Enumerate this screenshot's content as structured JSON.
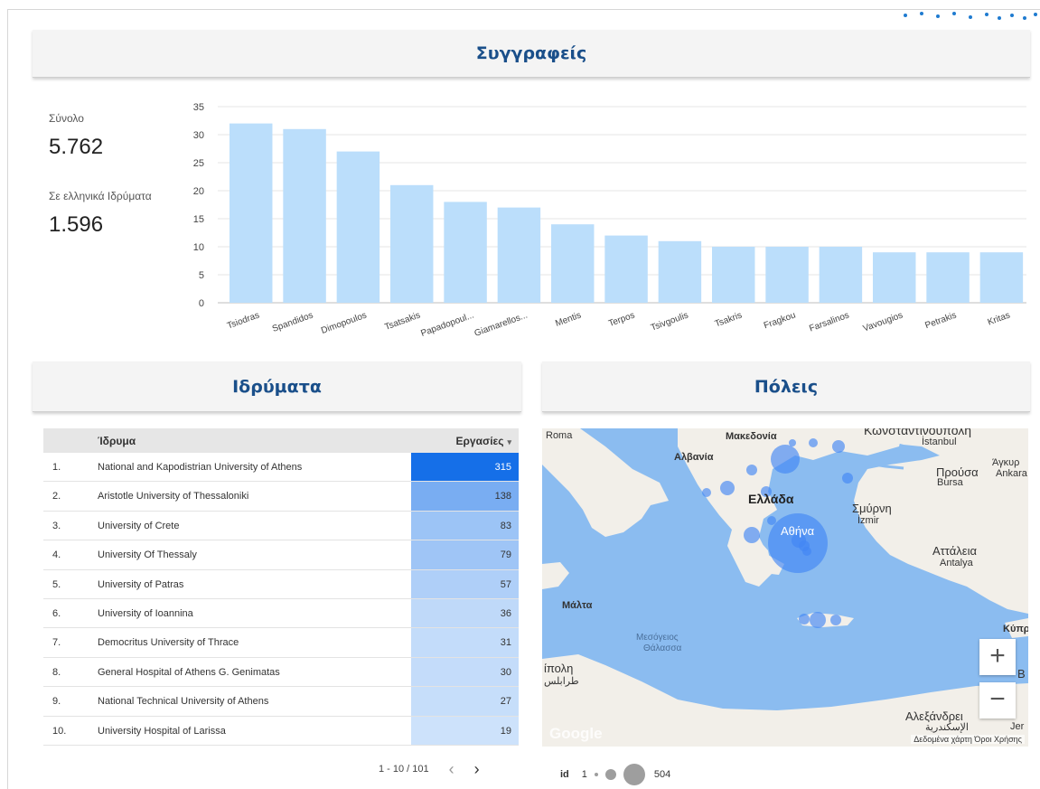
{
  "header_authors": "Συγγραφείς",
  "header_institutions": "Ιδρύματα",
  "header_cities": "Πόλεις",
  "kpis": {
    "total_label": "Σύνολο",
    "total_value": "5.762",
    "greek_label": "Σε ελληνικά Ιδρύματα",
    "greek_value": "1.596"
  },
  "chart_data": {
    "type": "bar",
    "categories": [
      "Tsiodras",
      "Spandidos",
      "Dimopoulos",
      "Tsatsakis",
      "Papadopoul...",
      "Giamarellos...",
      "Mentis",
      "Terpos",
      "Tsivgoulis",
      "Tsakris",
      "Fragkou",
      "Farsalinos",
      "Vavougios",
      "Petrakis",
      "Kritas"
    ],
    "values": [
      32,
      31,
      27,
      21,
      18,
      17,
      14,
      12,
      11,
      10,
      10,
      10,
      9,
      9,
      9
    ],
    "ylim": [
      0,
      35
    ],
    "yticks": [
      0,
      5,
      10,
      15,
      20,
      25,
      30,
      35
    ],
    "grid": true,
    "bar_color": "#bbdefb"
  },
  "table": {
    "col_institution": "Ίδρυμα",
    "col_works": "Εργασίες",
    "rows": [
      {
        "rank": "1.",
        "name": "National and Kapodistrian University of Athens",
        "count": "315",
        "value": 315
      },
      {
        "rank": "2.",
        "name": "Aristotle University of Thessaloniki",
        "count": "138",
        "value": 138
      },
      {
        "rank": "3.",
        "name": "University of Crete",
        "count": "83",
        "value": 83
      },
      {
        "rank": "4.",
        "name": "University Of Thessaly",
        "count": "79",
        "value": 79
      },
      {
        "rank": "5.",
        "name": "University of Patras",
        "count": "57",
        "value": 57
      },
      {
        "rank": "6.",
        "name": "University of Ioannina",
        "count": "36",
        "value": 36
      },
      {
        "rank": "7.",
        "name": "Democritus University of Thrace",
        "count": "31",
        "value": 31
      },
      {
        "rank": "8.",
        "name": "General Hospital of Athens G. Genimatas",
        "count": "30",
        "value": 30
      },
      {
        "rank": "9.",
        "name": "National Technical University of Athens",
        "count": "27",
        "value": 27
      },
      {
        "rank": "10.",
        "name": "University Hospital of Larissa",
        "count": "19",
        "value": 19
      }
    ],
    "pagination": "1 - 10 / 101"
  },
  "map": {
    "labels": {
      "roma": "Roma",
      "makedonia": "Μακεδονία",
      "kon": "Κωνσταντινούπολη",
      "istanbul": "İstanbul",
      "ankara_gr": "Άγκυρ",
      "ankara": "Ankara",
      "albania": "Αλβανία",
      "prousa": "Προύσα",
      "bursa": "Bursa",
      "ellada": "Ελλάδα",
      "smyrni": "Σμύρνη",
      "izmir": "İzmir",
      "athina": "Αθήνα",
      "attaleia": "Αττάλεια",
      "antalya": "Antalya",
      "malta": "Μάλτα",
      "kypros": "Κύπρ",
      "sea1": "Μεσόγειος",
      "sea2": "Θάλασσα",
      "tripoli": "ίπολη",
      "tripoli_ar": "طرابلس",
      "b": "B",
      "alex": "Αλεξάνδρει",
      "alex_ar": "الإسكندرية",
      "jer": "Jer"
    },
    "zoom_in": "+",
    "zoom_out": "−",
    "google": "Google",
    "attribution": "Δεδομένα χάρτη   Όροι Χρήσης",
    "legend_field": "id",
    "legend_min": "1",
    "legend_max": "504",
    "land_color": "#f2efe9",
    "sea_color": "#8bbcf0",
    "bubble_color": "#4285f4"
  }
}
